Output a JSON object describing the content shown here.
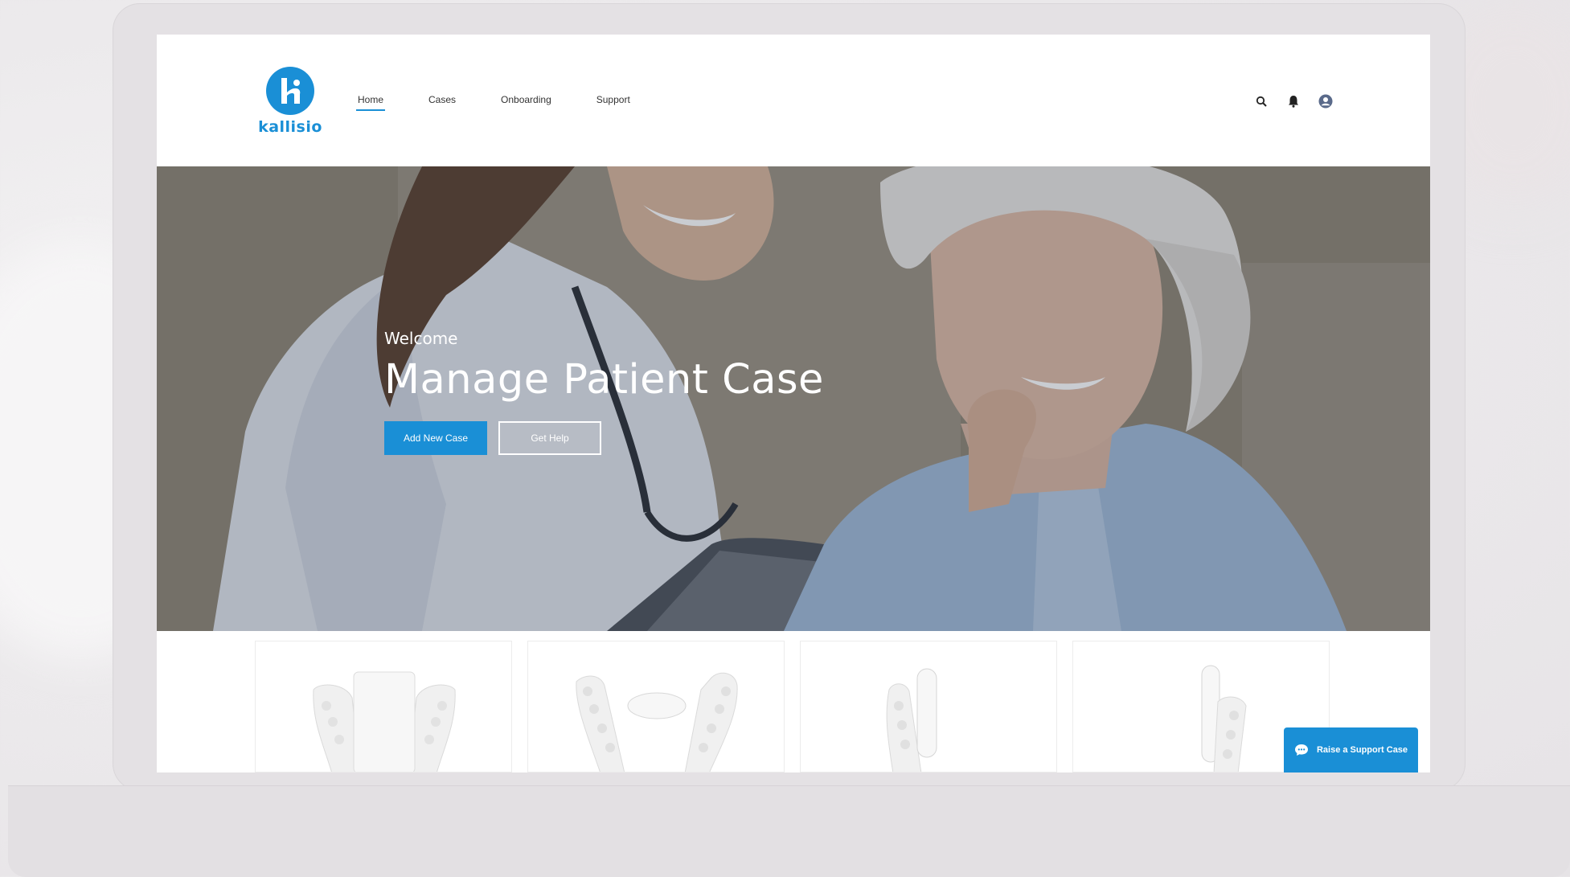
{
  "brand": {
    "name": "kallisio",
    "accent_color": "#1a8fd6"
  },
  "nav": {
    "items": [
      {
        "label": "Home",
        "active": true
      },
      {
        "label": "Cases",
        "active": false
      },
      {
        "label": "Onboarding",
        "active": false
      },
      {
        "label": "Support",
        "active": false
      }
    ]
  },
  "header_icons": [
    "search-icon",
    "bell-icon",
    "user-avatar-icon"
  ],
  "hero": {
    "welcome": "Welcome",
    "title": "Manage Patient Case",
    "primary_button": "Add New Case",
    "secondary_button": "Get Help"
  },
  "products": {
    "cards": [
      {
        "image": "dental-aligner-front-view"
      },
      {
        "image": "dental-aligner-top-view"
      },
      {
        "image": "dental-aligner-side-view"
      },
      {
        "image": "dental-aligner-side-view-alt"
      }
    ]
  },
  "support_chat": {
    "label": "Raise a Support Case",
    "icon": "chat-bubble-icon"
  }
}
